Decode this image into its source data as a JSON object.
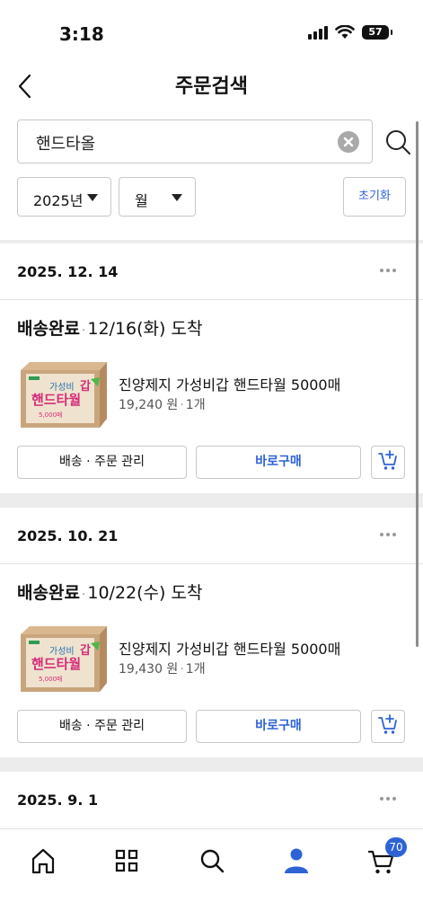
{
  "status_bar": {
    "time": "3:18",
    "battery": "57"
  },
  "header": {
    "title": "주문검색"
  },
  "search": {
    "query": "핸드타올"
  },
  "filters": {
    "year": "2025년",
    "month": "월",
    "reset_label": "초기화"
  },
  "orders": [
    {
      "date": "2025. 12. 14",
      "status": "배송완료",
      "arrival": "12/16(화) 도착",
      "product_name": "진양제지 가성비갑 핸드타월 5000매",
      "price": "19,240 원",
      "quantity": "1개",
      "manage_label": "배송 · 주문 관리",
      "rebuy_label": "바로구매"
    },
    {
      "date": "2025. 10. 21",
      "status": "배송완료",
      "arrival": "10/22(수) 도착",
      "product_name": "진양제지 가성비갑 핸드타월 5000매",
      "price": "19,430 원",
      "quantity": "1개",
      "manage_label": "배송 · 주문 관리",
      "rebuy_label": "바로구매"
    },
    {
      "date": "2025. 9. 1"
    }
  ],
  "product_box_text": {
    "line1": "가성비",
    "line2": "핸드타월",
    "count": "5,000매"
  },
  "tab_bar": {
    "items": [
      "home-icon",
      "grid-icon",
      "search-icon",
      "user-icon",
      "cart-icon"
    ],
    "cart_badge": "70"
  },
  "colors": {
    "accent": "#2e63d6",
    "background": "#ececec"
  }
}
